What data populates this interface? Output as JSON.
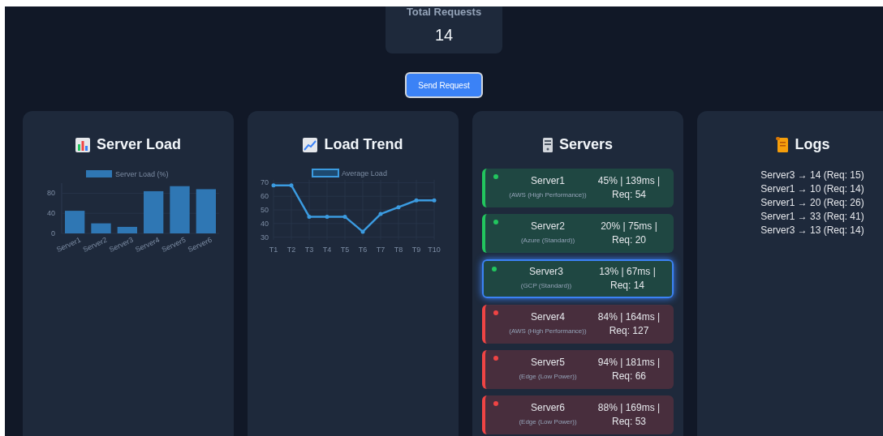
{
  "summary": {
    "label": "Total Requests",
    "value": "14"
  },
  "send_button": "Send Request",
  "panels": [
    {
      "kind": "bar_chart",
      "title": "Server Load",
      "chart_data": {
        "type": "bar",
        "categories": [
          "Server1",
          "Server2",
          "Server3",
          "Server4",
          "Server5",
          "Server6"
        ],
        "series": [
          {
            "name": "Server Load (%)",
            "color": "#2f77b4",
            "values": [
              45,
              20,
              13,
              84,
              94,
              88
            ]
          }
        ],
        "ylim": [
          0,
          100
        ],
        "yticks": [
          0,
          40,
          80
        ],
        "grid": true
      }
    },
    {
      "kind": "line_chart",
      "title": "Load Trend",
      "chart_data": {
        "type": "line",
        "categories": [
          "T1",
          "T2",
          "T3",
          "T4",
          "T5",
          "T6",
          "T7",
          "T8",
          "T9",
          "T10"
        ],
        "series": [
          {
            "name": "Average Load",
            "color": "#3b9be0",
            "values": [
              68,
              68,
              45,
              45,
              45,
              34,
              47,
              52,
              57,
              57
            ]
          }
        ],
        "ylim": [
          28,
          72
        ],
        "yticks": [
          30,
          40,
          50,
          60,
          70
        ],
        "grid": true
      }
    },
    {
      "kind": "servers",
      "title": "Servers",
      "servers": [
        {
          "name": "Server1",
          "type": "(AWS (High Performance))",
          "stats": "45% | 139ms | Req: 54",
          "color": "#22c55e",
          "selected": false
        },
        {
          "name": "Server2",
          "type": "(Azure (Standard))",
          "stats": "20% | 75ms | Req: 20",
          "color": "#22c55e",
          "selected": false
        },
        {
          "name": "Server3",
          "type": "(GCP (Standard))",
          "stats": "13% | 67ms | Req: 14",
          "color": "#22c55e",
          "selected": true
        },
        {
          "name": "Server4",
          "type": "(AWS (High Performance))",
          "stats": "84% | 164ms | Req: 127",
          "color": "#ef4444",
          "selected": false
        },
        {
          "name": "Server5",
          "type": "(Edge (Low Power))",
          "stats": "94% | 181ms | Req: 66",
          "color": "#ef4444",
          "selected": false
        },
        {
          "name": "Server6",
          "type": "(Edge (Low Power))",
          "stats": "88% | 169ms | Req: 53",
          "color": "#ef4444",
          "selected": false
        }
      ]
    },
    {
      "kind": "logs",
      "title": "Logs",
      "lines": [
        "Server3 → 14 (Req: 15)",
        "Server1 → 10 (Req: 14)",
        "Server1 → 20 (Req: 26)",
        "Server1 → 33 (Req: 41)",
        "Server3 → 13 (Req: 14)"
      ]
    }
  ]
}
